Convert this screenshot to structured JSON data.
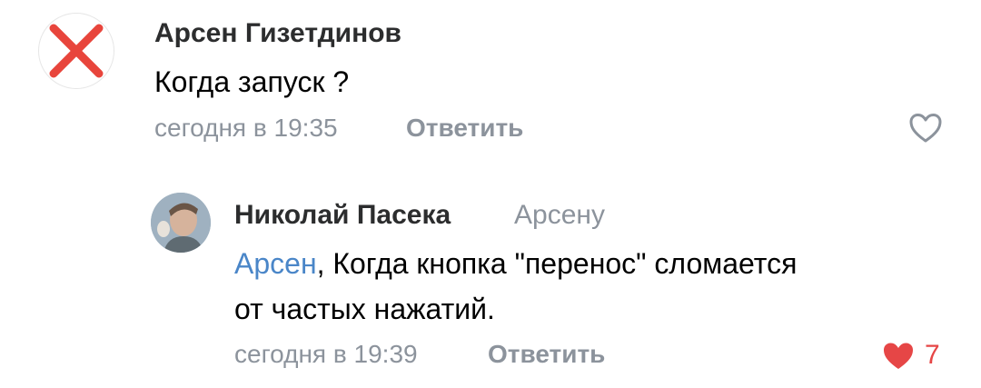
{
  "comments": [
    {
      "author": "Арсен Гизетдинов",
      "text": "Когда запуск ?",
      "time": "сегодня в 19:35",
      "reply_label": "Ответить",
      "avatar_icon": "cross-icon"
    },
    {
      "author": "Николай Пасека",
      "addressee": "Арсену",
      "mention": "Арсен",
      "text_line1": ", Когда кнопка \"перенос\" сломается",
      "text_line2": "от частых нажатий.",
      "time": "сегодня в 19:39",
      "reply_label": "Ответить",
      "likes": "7",
      "liked": true
    }
  ],
  "colors": {
    "link": "#4a86c8",
    "muted": "#8c939c",
    "like_active": "#e64646",
    "cross": "#e8453c"
  }
}
